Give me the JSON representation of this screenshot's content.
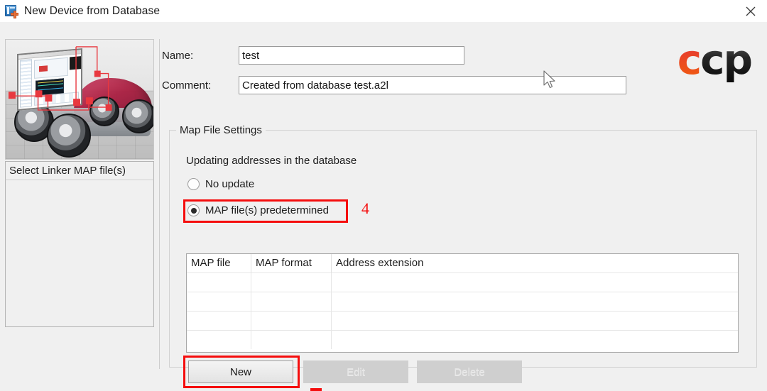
{
  "window": {
    "title": "New Device from Database",
    "icon": "device-add-icon",
    "close_label": "✕"
  },
  "left_panel": {
    "image_alt": "vehicle-measurement-illustration",
    "list_label": "Select Linker MAP file(s)",
    "items": []
  },
  "form": {
    "name": {
      "label": "Name:",
      "value": "test",
      "placeholder": ""
    },
    "comment": {
      "label": "Comment:",
      "value": "Created from database test.a2l",
      "placeholder": ""
    }
  },
  "logo": {
    "part1": "c",
    "part2": "cp",
    "color_accent": "#e8402a",
    "color_dark": "#1a1a1a"
  },
  "group": {
    "title": "Map File Settings",
    "subtitle": "Updating addresses in the database",
    "radios": [
      {
        "label": "No update",
        "checked": false
      },
      {
        "label": "MAP file(s) predetermined",
        "checked": true
      }
    ]
  },
  "table": {
    "columns": [
      "MAP file",
      "MAP format",
      "Address extension"
    ],
    "rows": [],
    "empty_row_count": 4
  },
  "buttons": {
    "new": {
      "label": "New",
      "enabled": true
    },
    "edit": {
      "label": "Edit",
      "enabled": false
    },
    "delete": {
      "label": "Delete",
      "enabled": false
    }
  },
  "annotations": {
    "step_number": "4",
    "highlight_color": "#f50d0d"
  }
}
